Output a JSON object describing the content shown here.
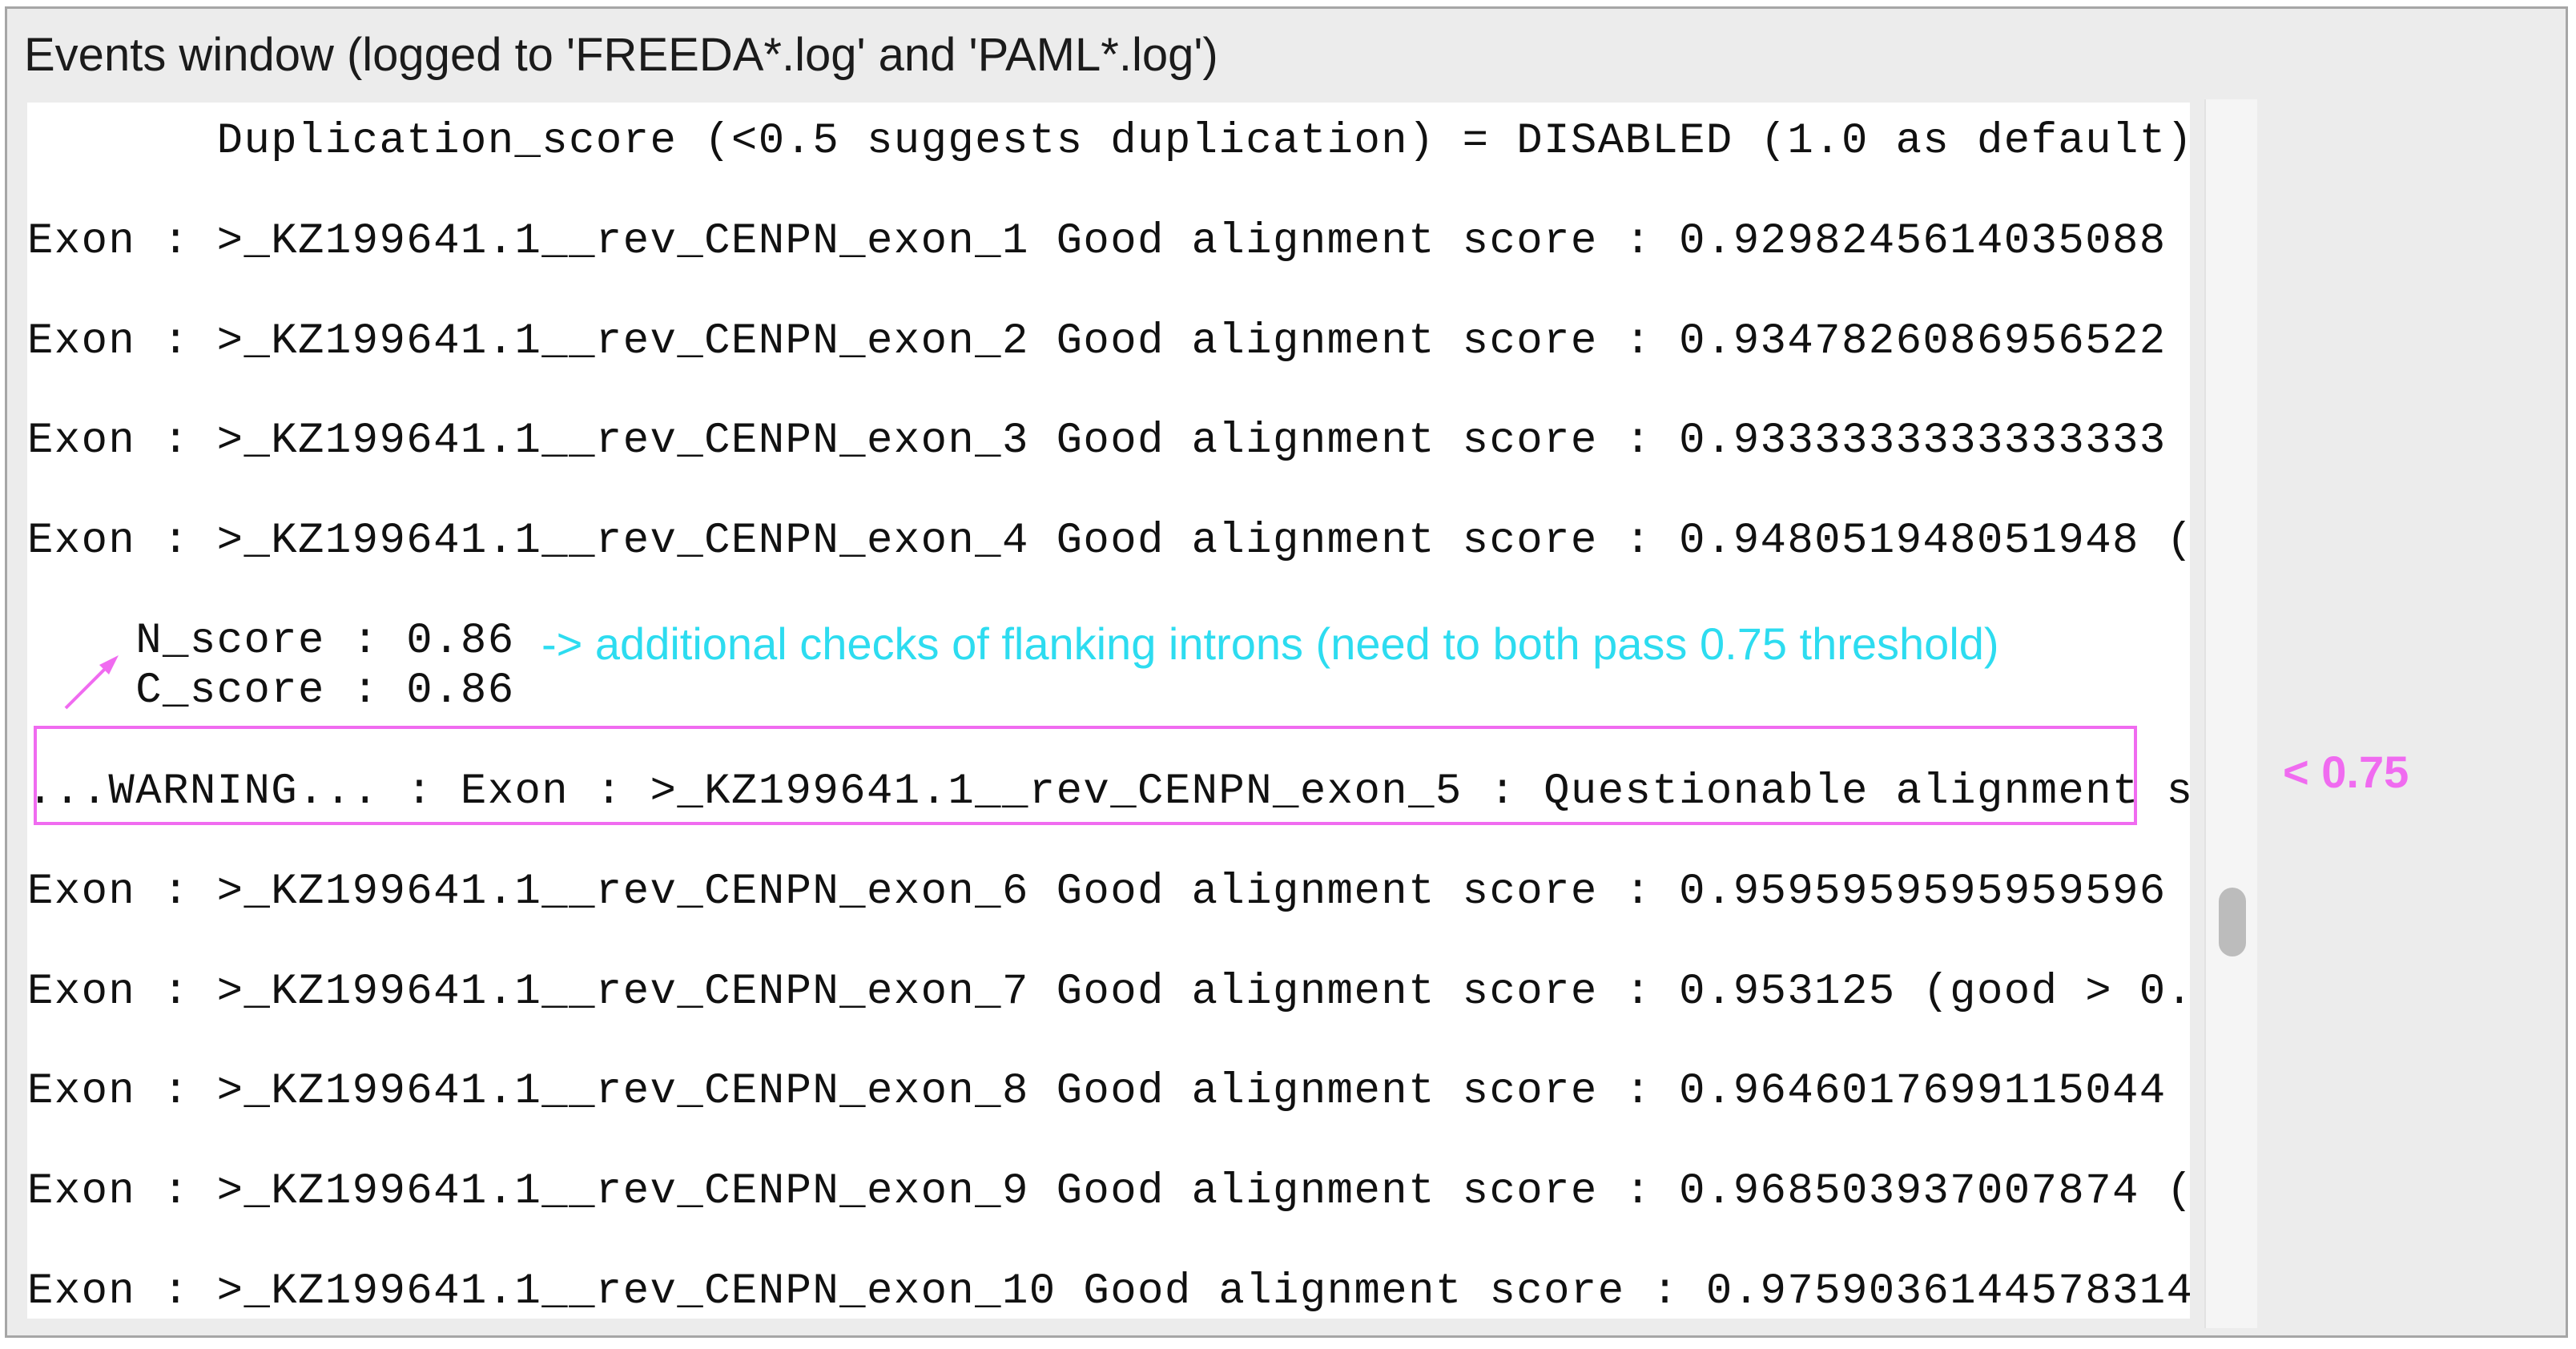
{
  "window": {
    "title": "Events window (logged to 'FREEDA*.log' and 'PAML*.log')"
  },
  "log_lines": [
    "       Duplication_score (<0.5 suggests duplication) = DISABLED (1.0 as default)",
    "Exon : >_KZ199641.1__rev_CENPN_exon_1 Good alignment score : 0.9298245614035088",
    "Exon : >_KZ199641.1__rev_CENPN_exon_2 Good alignment score : 0.9347826086956522",
    "Exon : >_KZ199641.1__rev_CENPN_exon_3 Good alignment score : 0.9333333333333333",
    "Exon : >_KZ199641.1__rev_CENPN_exon_4 Good alignment score : 0.948051948051948 (",
    "    N_score : 0.86",
    "    C_score : 0.86",
    "...WARNING... : Exon : >_KZ199641.1__rev_CENPN_exon_5 : Questionable alignment s",
    "Exon : >_KZ199641.1__rev_CENPN_exon_6 Good alignment score : 0.9595959595959596",
    "Exon : >_KZ199641.1__rev_CENPN_exon_7 Good alignment score : 0.953125 (good > 0.",
    "Exon : >_KZ199641.1__rev_CENPN_exon_8 Good alignment score : 0.9646017699115044",
    "Exon : >_KZ199641.1__rev_CENPN_exon_9 Good alignment score : 0.968503937007874 (",
    "Exon : >_KZ199641.1__rev_CENPN_exon_10 Good alignment score : 0.9759036144578314"
  ],
  "annotations": {
    "flanking_note": "-> additional checks of flanking introns (need to both pass 0.75 threshold)",
    "threshold": "< 0.75"
  },
  "colors": {
    "annotation_cyan": "#2ddcf0",
    "highlight_magenta": "#f06bf0"
  }
}
